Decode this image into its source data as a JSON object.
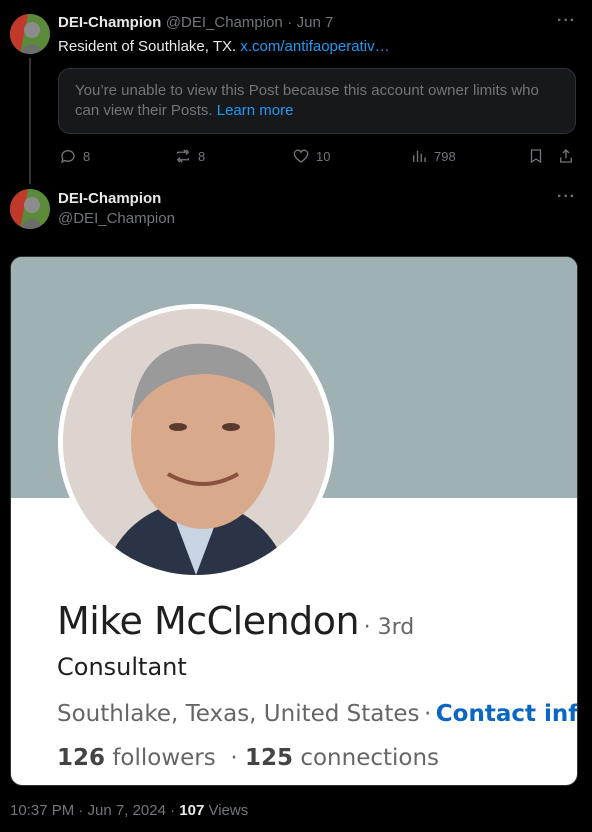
{
  "tweet1": {
    "author_name": "DEI-Champion",
    "handle": "@DEI_Champion",
    "separator": "·",
    "date": "Jun 7",
    "text": "Resident of Southlake, TX.",
    "link": "x.com/antifaoperativ…",
    "notice_text": "You’re unable to view this Post because this account owner limits who can view their Posts.",
    "notice_link": "Learn more",
    "replies": "8",
    "reposts": "8",
    "likes": "10",
    "views": "798"
  },
  "tweet2": {
    "author_name": "DEI-Champion",
    "handle": "@DEI_Champion",
    "profile_card": {
      "name": "Mike McClendon",
      "degree": "· 3rd",
      "headline": "Consultant",
      "location": "Southlake, Texas, United States",
      "loc_sep": "·",
      "contact": "Contact info",
      "followers_num": "126",
      "followers_label": "followers",
      "stat_sep": "·",
      "connections_num": "125",
      "connections_label": "connections"
    },
    "timestamp": "10:37 PM · Jun 7, 2024 ·",
    "views_count": "107",
    "views_label": "Views"
  },
  "colors": {
    "link": "#1d9bf0",
    "linkedin_blue": "#0a66c2",
    "banner": "#a0b1b4"
  }
}
